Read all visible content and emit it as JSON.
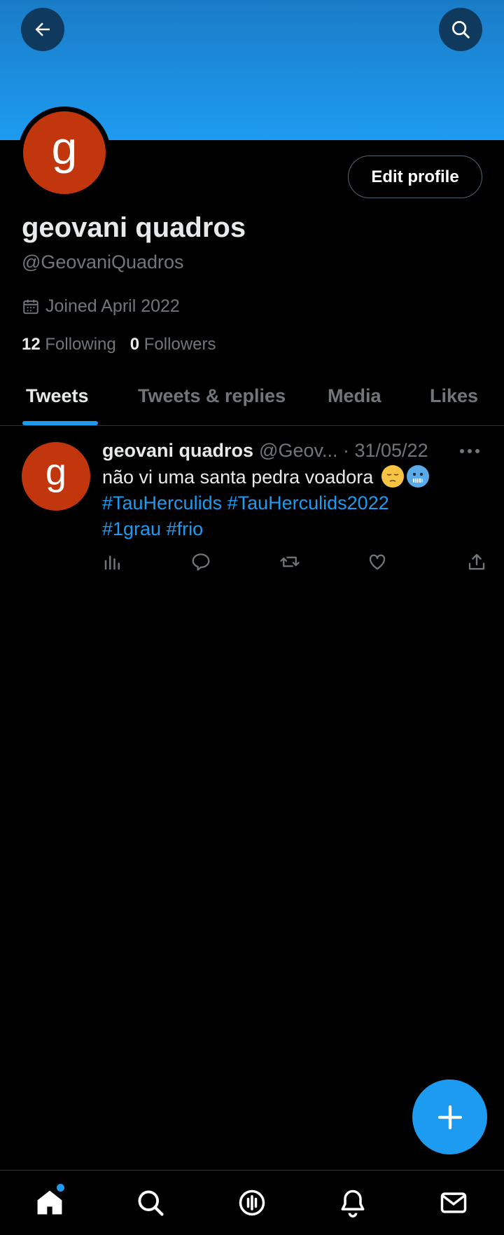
{
  "profile": {
    "avatar_letter": "g",
    "name": "geovani quadros",
    "handle": "@GeovaniQuadros",
    "joined": "Joined April 2022",
    "following_count": "12",
    "following_label": "Following",
    "followers_count": "0",
    "followers_label": "Followers",
    "edit_label": "Edit profile"
  },
  "tabs": [
    {
      "label": "Tweets",
      "active": true
    },
    {
      "label": "Tweets & replies",
      "active": false
    },
    {
      "label": "Media",
      "active": false
    },
    {
      "label": "Likes",
      "active": false
    }
  ],
  "tweet": {
    "name": "geovani quadros",
    "meta": "@Geov... · 31/05/22",
    "text": "não vi uma santa pedra voadora",
    "tags_line1": "#TauHerculids #TauHerculids2022",
    "tags_line2": "#1grau #frio",
    "actions": [
      "analytics-icon",
      "reply-icon",
      "retweet-icon",
      "like-icon",
      "share-icon"
    ]
  },
  "colors": {
    "accent": "#1d9bf0",
    "avatar": "#c1360d",
    "muted": "#71767b"
  },
  "icons": [
    "back-arrow-icon",
    "search-icon",
    "calendar-icon",
    "more-icon",
    "compose-plus-icon",
    "home-icon",
    "spaces-icon",
    "notifications-icon",
    "messages-icon"
  ]
}
